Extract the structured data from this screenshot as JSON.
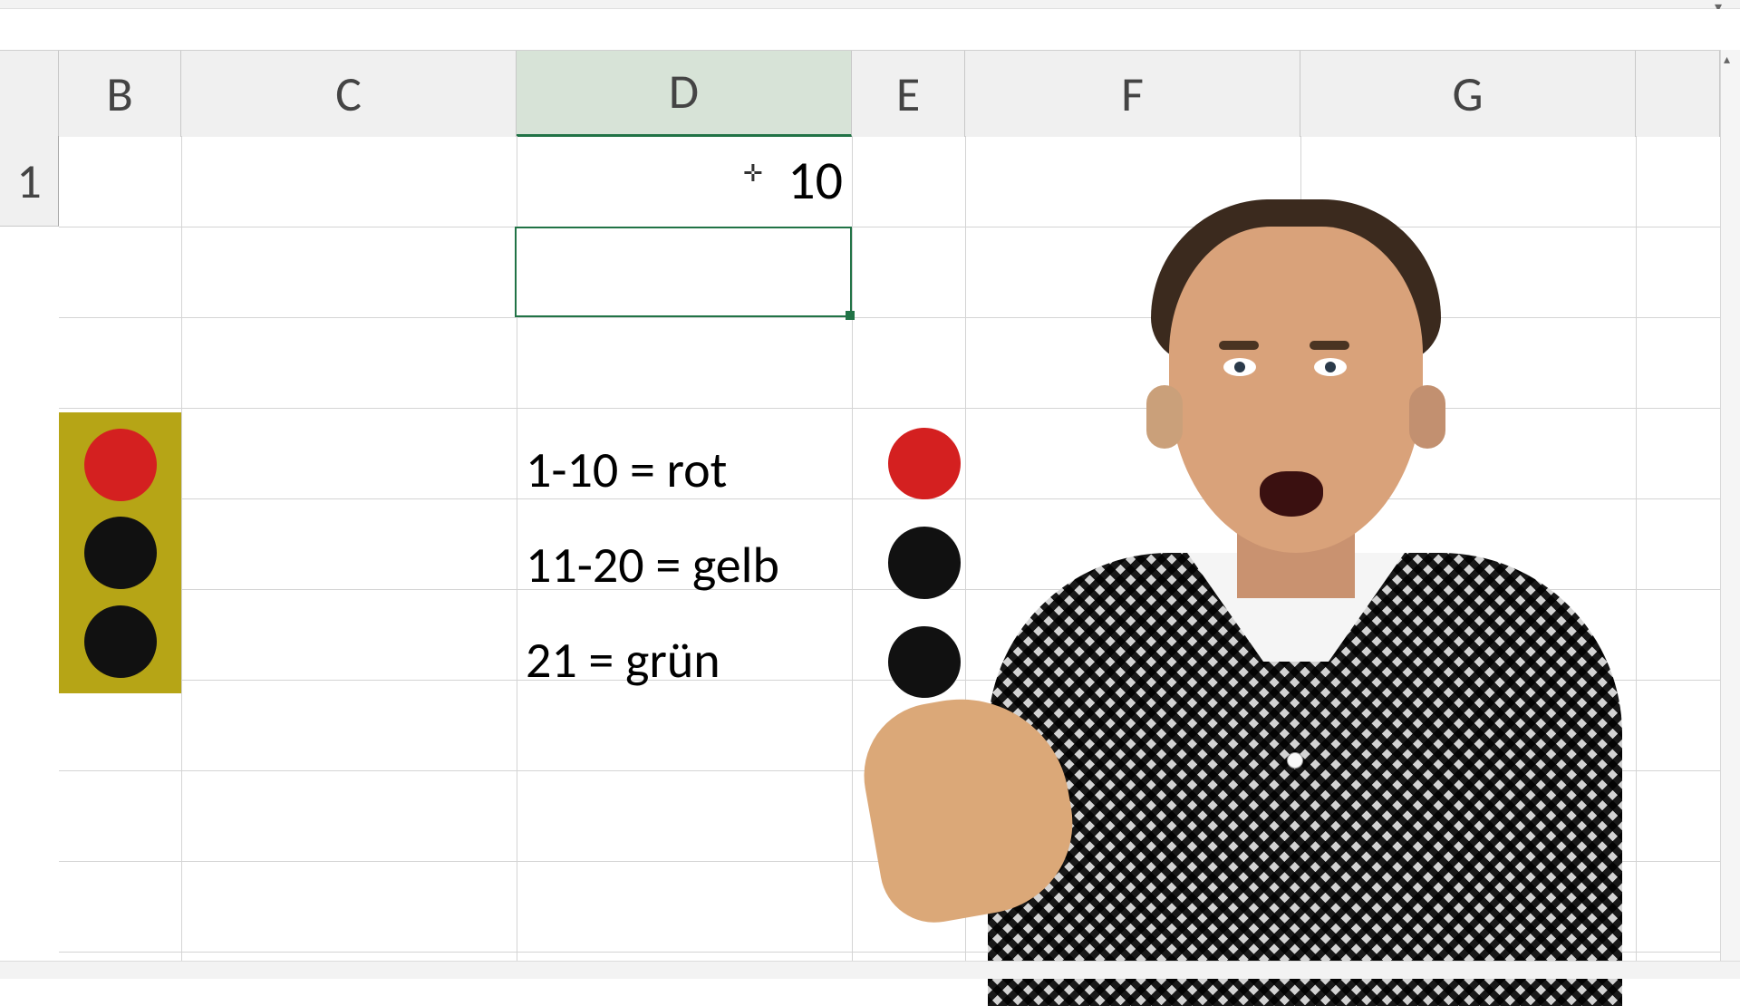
{
  "columns": {
    "B": "B",
    "C": "C",
    "D": "D",
    "E": "E",
    "F": "F",
    "G": "G"
  },
  "rows": {
    "r1": "1"
  },
  "cells": {
    "D1": "10"
  },
  "rules": {
    "r1": "1-10 = rot",
    "r2": "11-20 = gelb",
    "r3": "21 = grün"
  },
  "colors": {
    "red": "#d42020",
    "black": "#111111",
    "housing": "#b6a516",
    "selection": "#217346"
  },
  "cursor_glyph": "✛",
  "scroll_up_glyph": "▴",
  "chrome_dropdown_glyph": "▾"
}
